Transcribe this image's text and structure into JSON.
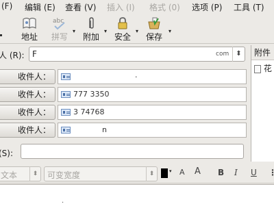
{
  "menubar": {
    "items": [
      {
        "label": "(F)",
        "disabled": false
      },
      {
        "label": "编辑 (E)",
        "disabled": false
      },
      {
        "label": "查看 (V)",
        "disabled": false
      },
      {
        "label": "插入 (I)",
        "disabled": true
      },
      {
        "label": "格式 (0)",
        "disabled": true
      },
      {
        "label": "选项 (P)",
        "disabled": false
      },
      {
        "label": "工具 (T)",
        "disabled": false
      }
    ]
  },
  "toolbar": {
    "buttons": [
      {
        "label": "地址",
        "icon": "address-book-icon",
        "disabled": false
      },
      {
        "label": "拼写",
        "icon": "spellcheck-icon",
        "disabled": true
      },
      {
        "label": "附加",
        "icon": "paperclip-icon",
        "disabled": false
      },
      {
        "label": "安全",
        "icon": "lock-icon",
        "disabled": false
      },
      {
        "label": "保存",
        "icon": "save-icon",
        "disabled": false
      }
    ]
  },
  "compose": {
    "from_label": "人 (R):",
    "from_value": "F",
    "from_value_right": "com",
    "recipient_label": "收件人：",
    "recipients": [
      {
        "value": "."
      },
      {
        "value": "777  3350"
      },
      {
        "value": "3  74768"
      },
      {
        "value": "n"
      }
    ],
    "subject_label": "(S):",
    "subject_value": ""
  },
  "attachments": {
    "header": "附件",
    "item_label": "花"
  },
  "format_bar": {
    "paragraph_style": "文本",
    "font_width": "可变宽度",
    "text_color": "#000000",
    "shrink_label": "A",
    "grow_label": "A",
    "bold_label": "B",
    "italic_label": "I",
    "underline_label": "U"
  },
  "editor": {
    "body_text": "."
  }
}
